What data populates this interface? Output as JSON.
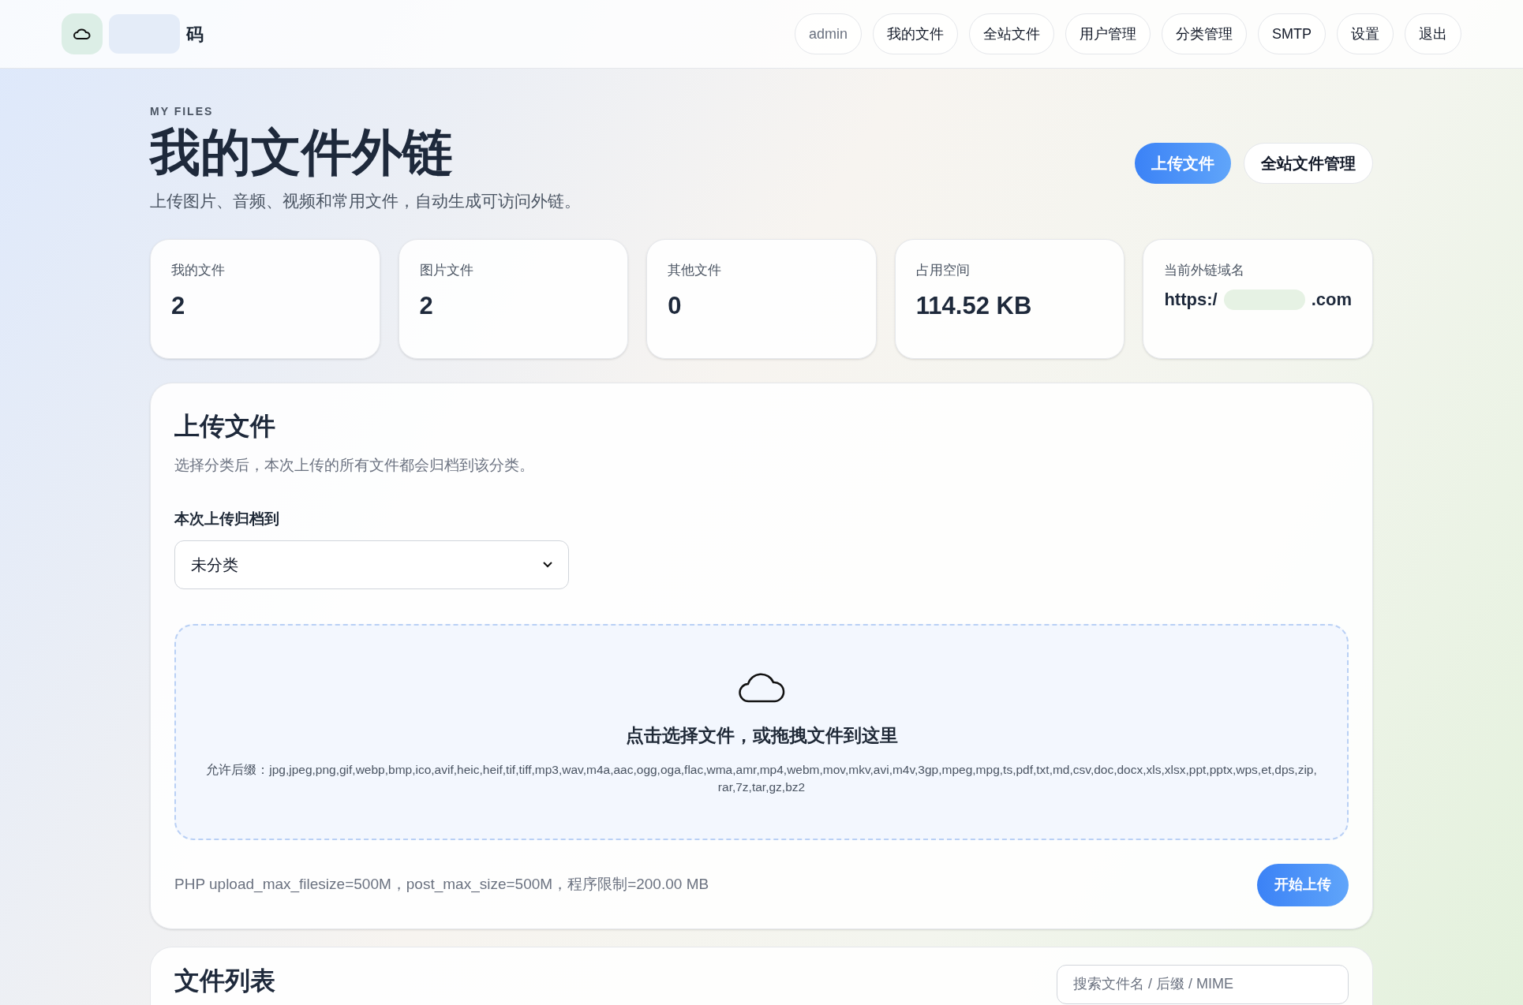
{
  "header": {
    "logo_text": "码",
    "nav": [
      {
        "label": "admin",
        "kind": "user"
      },
      {
        "label": "我的文件",
        "kind": "link"
      },
      {
        "label": "全站文件",
        "kind": "link"
      },
      {
        "label": "用户管理",
        "kind": "link"
      },
      {
        "label": "分类管理",
        "kind": "link"
      },
      {
        "label": "SMTP",
        "kind": "link"
      },
      {
        "label": "设置",
        "kind": "link"
      },
      {
        "label": "退出",
        "kind": "link"
      }
    ]
  },
  "hero": {
    "eyebrow": "MY FILES",
    "title": "我的文件外链",
    "subtitle": "上传图片、音频、视频和常用文件，自动生成可访问外链。",
    "actions": [
      {
        "label": "上传文件",
        "kind": "primary"
      },
      {
        "label": "全站文件管理",
        "kind": "secondary"
      }
    ]
  },
  "stats": [
    {
      "label": "我的文件",
      "value": "2"
    },
    {
      "label": "图片文件",
      "value": "2"
    },
    {
      "label": "其他文件",
      "value": "0"
    },
    {
      "label": "占用空间",
      "value": "114.52 KB"
    },
    {
      "label": "当前外链域名",
      "value_start": "https:/",
      "value_end": ".com"
    }
  ],
  "upload": {
    "title": "上传文件",
    "description": "选择分类后，本次上传的所有文件都会归档到该分类。",
    "category_label": "本次上传归档到",
    "category_value": "未分类",
    "drop_title": "点击选择文件，或拖拽文件到这里",
    "allowed": "允许后缀：jpg,jpeg,png,gif,webp,bmp,ico,avif,heic,heif,tif,tiff,mp3,wav,m4a,aac,ogg,oga,flac,wma,amr,mp4,webm,mov,mkv,avi,m4v,3gp,mpeg,mpg,ts,pdf,txt,md,csv,doc,docx,xls,xlsx,ppt,pptx,wps,et,dps,zip,rar,7z,tar,gz,bz2",
    "limits": "PHP upload_max_filesize=500M，post_max_size=500M，程序限制=200.00 MB",
    "submit": "开始上传"
  },
  "file_list": {
    "title": "文件列表",
    "search_placeholder": "搜索文件名 / 后缀 / MIME"
  }
}
